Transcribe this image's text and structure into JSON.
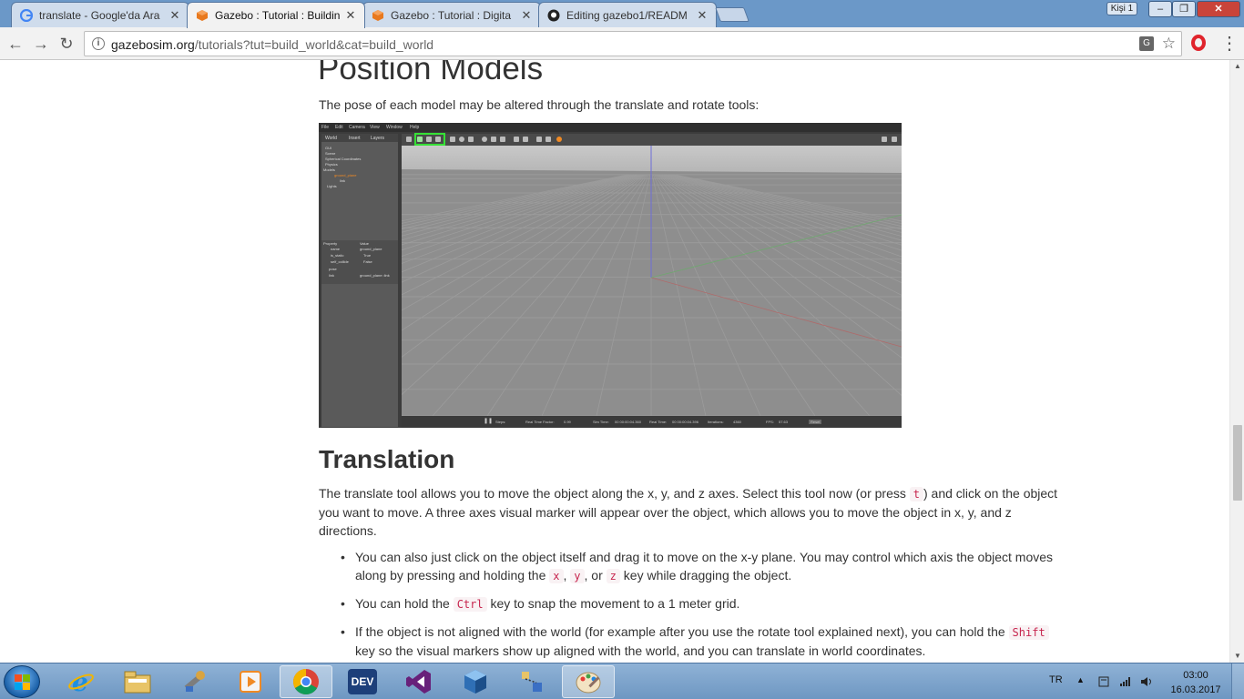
{
  "browser": {
    "tabs": [
      {
        "title": "translate - Google'da Ara",
        "icon": "google-icon",
        "active": false
      },
      {
        "title": "Gazebo : Tutorial : Buildin",
        "icon": "gazebo-icon",
        "active": true
      },
      {
        "title": "Gazebo : Tutorial : Digita",
        "icon": "gazebo-icon",
        "active": false
      },
      {
        "title": "Editing gazebo1/READM",
        "icon": "github-icon",
        "active": false
      }
    ],
    "close_glyph": "✕",
    "profile_label": "Kişi 1",
    "window_controls": {
      "minimize": "–",
      "maximize": "❐",
      "close": "✕"
    },
    "nav": {
      "back": "←",
      "forward": "→",
      "reload": "↻"
    },
    "url_host": "gazebosim.org",
    "url_path": "/tutorials?tut=build_world&cat=build_world",
    "translate_glyph": "G",
    "star_glyph": "☆",
    "menu_glyph": "⋮"
  },
  "page": {
    "heading_position": "Position Models",
    "pose_text": "The pose of each model may be altered through the translate and rotate tools:",
    "heading_translation": "Translation",
    "translation_para": {
      "p1": "The translate tool allows you to move the object along the x, y, and z axes. Select this tool now (or press ",
      "key_t": "t",
      "p2": ") and click on the object you want to move. A three axes visual marker will appear over the object, which allows you to move the object in x, y, and z directions."
    },
    "bullets": [
      {
        "a": "You can also just click on the object itself and drag it to move on the x-y plane. You may control which axis the object moves along by pressing and holding the ",
        "k1": "x",
        "s1": ", ",
        "k2": "y",
        "s2": ", or ",
        "k3": "z",
        "b": " key while dragging the object."
      },
      {
        "a": "You can hold the ",
        "k1": "Ctrl",
        "b": " key to snap the movement to a 1 meter grid."
      },
      {
        "a": "If the object is not aligned with the world (for example after you use the rotate tool explained next), you can hold the ",
        "k1": "Shift",
        "b": " key so the visual markers show up aligned with the world, and you can translate in world coordinates."
      }
    ]
  },
  "gazebo": {
    "menu": [
      "File",
      "Edit",
      "Camera",
      "View",
      "Window",
      "Help"
    ],
    "left_tabs": [
      "World",
      "Insert",
      "Layers"
    ],
    "tree": [
      "GUI",
      "Scene",
      "Spherical Coordinates",
      "Physics",
      "Models",
      "ground_plane",
      "link",
      "Lights"
    ],
    "prop_headers": [
      "Property",
      "Value"
    ],
    "props": [
      [
        "name",
        "ground_plane"
      ],
      [
        "is_static",
        "True"
      ],
      [
        "self_collide",
        "False"
      ],
      [
        "pose",
        ""
      ],
      [
        "link",
        "ground_plane::link"
      ]
    ],
    "status": {
      "steps": "Steps:",
      "rtf_label": "Real Time Factor:",
      "rtf": "0.99",
      "sim_label": "Sim Time:",
      "sim": "00 00:00:04.360",
      "real_label": "Real Time:",
      "real": "00 00:00:04.396",
      "iter_label": "Iterations:",
      "iter": "4360",
      "fps_label": "FPS:",
      "fps": "57.63",
      "reset": "Reset"
    }
  },
  "scrollbar": {
    "up": "▲",
    "down": "▼"
  },
  "taskbar": {
    "apps": [
      "ie-icon",
      "file-explorer-icon",
      "tools-icon",
      "media-player-icon",
      "chrome-icon",
      "devcpp-icon",
      "visual-studio-icon",
      "virtualbox-icon",
      "network-tool-icon",
      "paint-icon"
    ],
    "devcpp_label": "DEV",
    "lang": "TR",
    "tray_arrow": "▲",
    "time": "03:00",
    "date": "16.03.2017"
  },
  "colors": {
    "accent": "#6b98c8",
    "code_text": "#c7254e",
    "code_bg": "#f9f2f4",
    "highlight_green": "#35e135"
  }
}
